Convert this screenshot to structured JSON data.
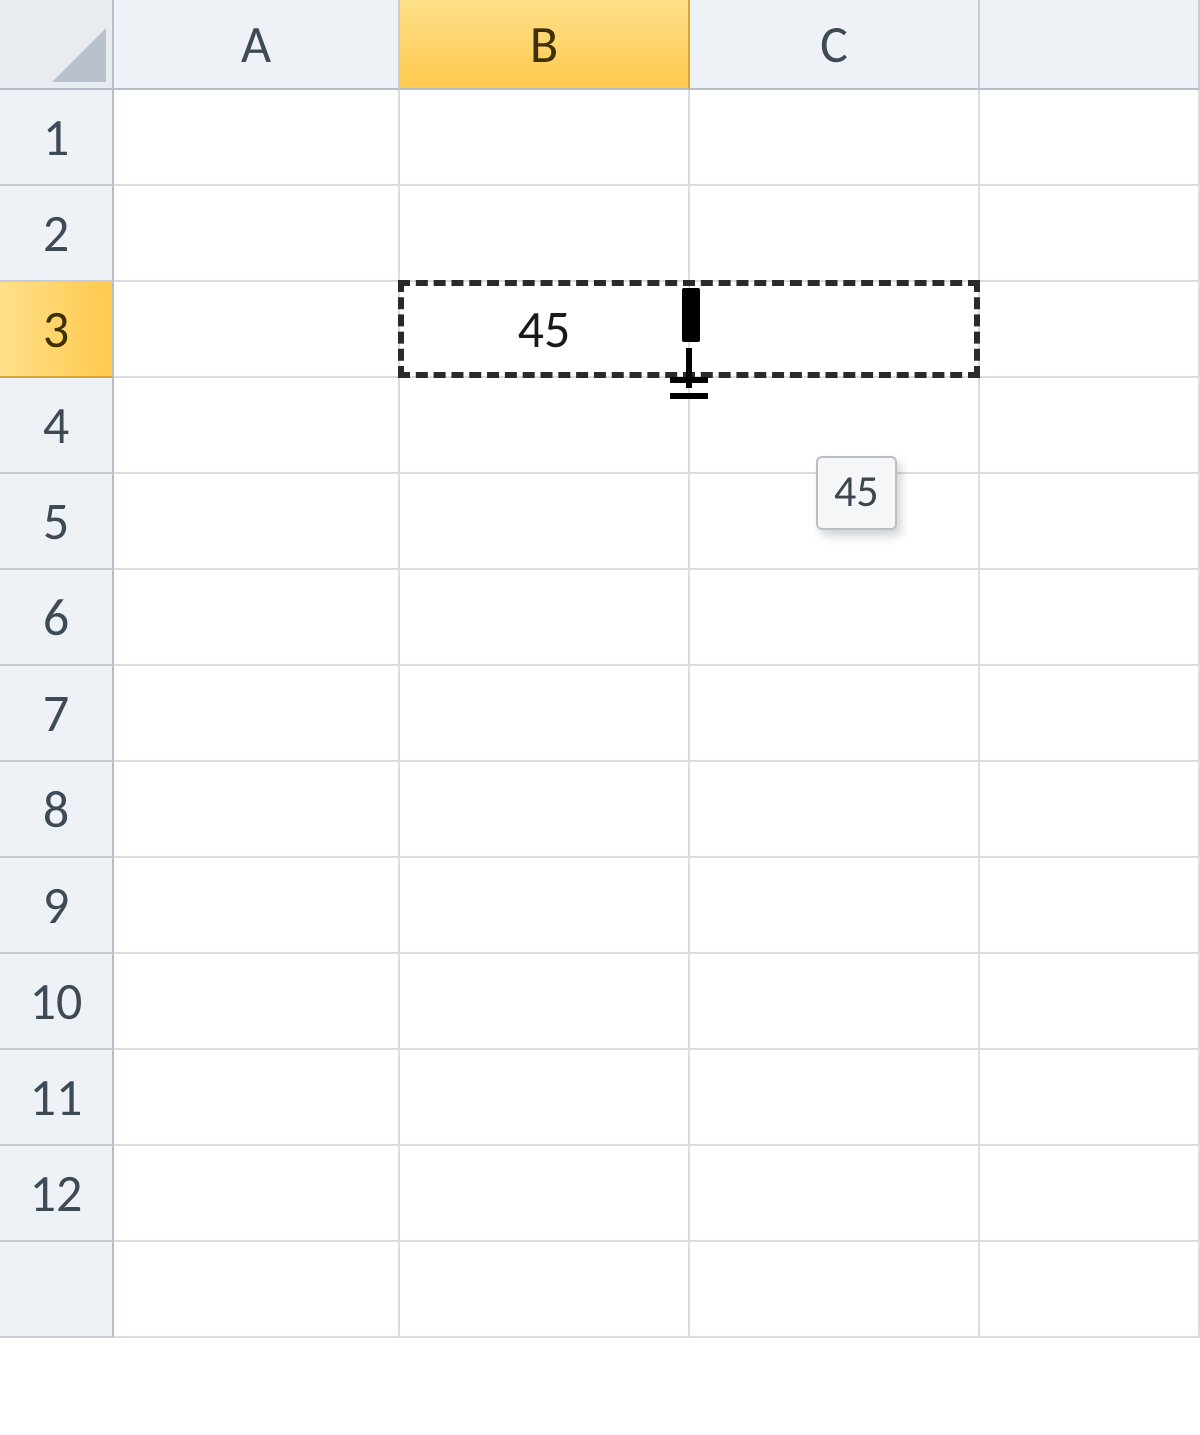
{
  "columns": {
    "A": "A",
    "B": "B",
    "C": "C"
  },
  "rows": {
    "1": "1",
    "2": "2",
    "3": "3",
    "4": "4",
    "5": "5",
    "6": "6",
    "7": "7",
    "8": "8",
    "9": "9",
    "10": "10",
    "11": "11",
    "12": "12"
  },
  "selected_column": "B",
  "selected_row": "3",
  "cells": {
    "B3": "45"
  },
  "fill_preview_tooltip": "45"
}
